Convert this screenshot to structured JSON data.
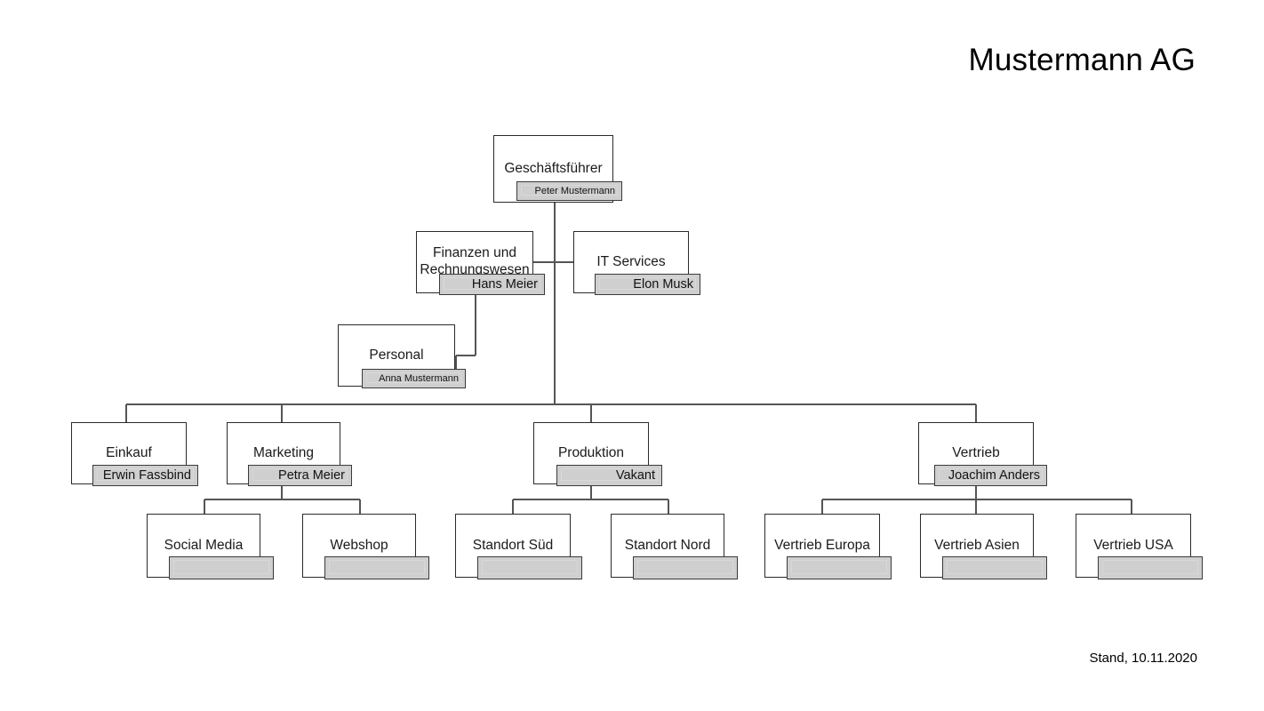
{
  "header": {
    "title": "Mustermann AG"
  },
  "footer": {
    "note": "Stand, 10.11.2020"
  },
  "colors": {
    "badge_fill": "#cfcfcf",
    "box_border": "#2a2a2a",
    "badge_border": "#3a3a3a",
    "line": "#555555",
    "text": "#1a1a1a",
    "background": "#ffffff"
  },
  "chart_data": {
    "type": "diagram",
    "diagram_kind": "organizational-chart",
    "title": "Mustermann AG",
    "nodes": [
      {
        "id": "ceo",
        "role": "Geschäftsführer",
        "person": "Peter Mustermann",
        "level": 1,
        "parent": null
      },
      {
        "id": "finanzen",
        "role": "Finanzen und\nRechnungswesen",
        "person": "Hans Meier",
        "level": 2,
        "parent": "ceo"
      },
      {
        "id": "it",
        "role": "IT Services",
        "person": "Elon Musk",
        "level": 2,
        "parent": "ceo"
      },
      {
        "id": "personal",
        "role": "Personal",
        "person": "Anna Mustermann",
        "level": 3,
        "parent": "finanzen"
      },
      {
        "id": "einkauf",
        "role": "Einkauf",
        "person": "Erwin Fassbind",
        "level": 4,
        "parent": "ceo"
      },
      {
        "id": "marketing",
        "role": "Marketing",
        "person": "Petra Meier",
        "level": 4,
        "parent": "ceo"
      },
      {
        "id": "produktion",
        "role": "Produktion",
        "person": "Vakant",
        "level": 4,
        "parent": "ceo"
      },
      {
        "id": "vertrieb",
        "role": "Vertrieb",
        "person": "Joachim Anders",
        "level": 4,
        "parent": "ceo"
      },
      {
        "id": "socialmedia",
        "role": "Social Media",
        "person": "",
        "level": 5,
        "parent": "marketing"
      },
      {
        "id": "webshop",
        "role": "Webshop",
        "person": "",
        "level": 5,
        "parent": "marketing"
      },
      {
        "id": "standortsued",
        "role": "Standort Süd",
        "person": "",
        "level": 5,
        "parent": "produktion"
      },
      {
        "id": "standortnord",
        "role": "Standort Nord",
        "person": "",
        "level": 5,
        "parent": "produktion"
      },
      {
        "id": "vertriebeuropa",
        "role": "Vertrieb Europa",
        "person": "",
        "level": 5,
        "parent": "vertrieb"
      },
      {
        "id": "vertriebasien",
        "role": "Vertrieb Asien",
        "person": "",
        "level": 5,
        "parent": "vertrieb"
      },
      {
        "id": "vertriebusa",
        "role": "Vertrieb USA",
        "person": "",
        "level": 5,
        "parent": "vertrieb"
      }
    ]
  },
  "nodes": {
    "ceo": {
      "role": "Geschäftsführer",
      "person": "Peter Mustermann"
    },
    "finanzen": {
      "role": "Finanzen und\nRechnungswesen",
      "person": "Hans Meier"
    },
    "it": {
      "role": "IT Services",
      "person": "Elon Musk"
    },
    "personal": {
      "role": "Personal",
      "person": "Anna Mustermann"
    },
    "einkauf": {
      "role": "Einkauf",
      "person": "Erwin Fassbind"
    },
    "marketing": {
      "role": "Marketing",
      "person": "Petra Meier"
    },
    "produktion": {
      "role": "Produktion",
      "person": "Vakant"
    },
    "vertrieb": {
      "role": "Vertrieb",
      "person": "Joachim Anders"
    },
    "socialmedia": {
      "role": "Social Media",
      "person": ""
    },
    "webshop": {
      "role": "Webshop",
      "person": ""
    },
    "standortsued": {
      "role": "Standort Süd",
      "person": ""
    },
    "standortnord": {
      "role": "Standort Nord",
      "person": ""
    },
    "vertriebeuropa": {
      "role": "Vertrieb Europa",
      "person": ""
    },
    "vertriebasien": {
      "role": "Vertrieb Asien",
      "person": ""
    },
    "vertriebusa": {
      "role": "Vertrieb USA",
      "person": ""
    }
  }
}
